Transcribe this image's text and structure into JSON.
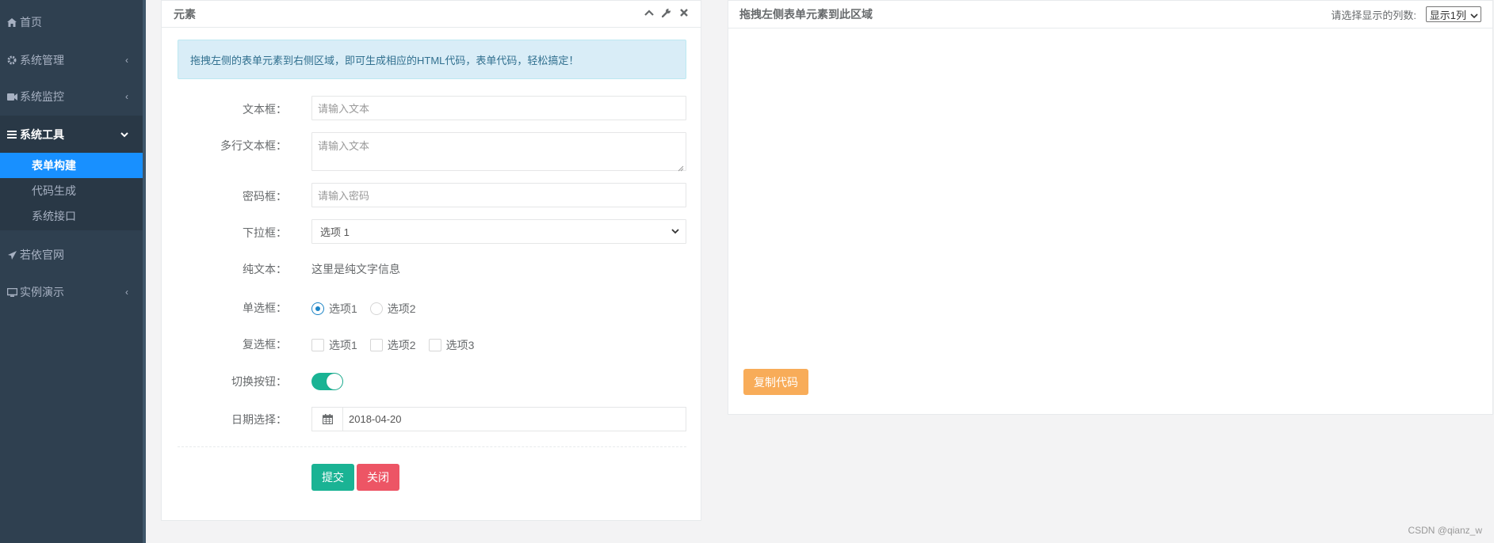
{
  "sidebar": {
    "items": [
      {
        "label": "首页",
        "icon": "home-icon"
      },
      {
        "label": "系统管理",
        "icon": "gear-icon"
      },
      {
        "label": "系统监控",
        "icon": "video-camera-icon"
      },
      {
        "label": "系统工具",
        "icon": "bars-icon"
      },
      {
        "label": "若依官网",
        "icon": "paper-plane-icon"
      },
      {
        "label": "实例演示",
        "icon": "desktop-icon"
      }
    ],
    "subitems": [
      {
        "label": "表单构建"
      },
      {
        "label": "代码生成"
      },
      {
        "label": "系统接口"
      }
    ]
  },
  "left_panel": {
    "title": "元素",
    "alert": "拖拽左侧的表单元素到右侧区域，即可生成相应的HTML代码，表单代码，轻松搞定！",
    "form": {
      "text_label": "文本框：",
      "text_placeholder": "请输入文本",
      "textarea_label": "多行文本框：",
      "textarea_placeholder": "请输入文本",
      "password_label": "密码框：",
      "password_placeholder": "请输入密码",
      "select_label": "下拉框：",
      "select_value": "选项 1",
      "static_label": "纯文本：",
      "static_value": "这里是纯文字信息",
      "radio_label": "单选框：",
      "radio_options": [
        "选项1",
        "选项2"
      ],
      "checkbox_label": "复选框：",
      "checkbox_options": [
        "选项1",
        "选项2",
        "选项3"
      ],
      "toggle_label": "切换按钮：",
      "date_label": "日期选择：",
      "date_value": "2018-04-20"
    },
    "buttons": {
      "submit": "提交",
      "close": "关闭"
    }
  },
  "right_panel": {
    "title": "拖拽左侧表单元素到此区域",
    "columns_label": "请选择显示的列数:",
    "columns_value": "显示1列",
    "copy_button": "复制代码"
  },
  "watermark": "CSDN @qianz_w",
  "colors": {
    "sidebar_bg": "#2f4050",
    "active_blue": "#1890ff",
    "primary_green": "#1ab394",
    "danger_red": "#ed5565",
    "warning_orange": "#f8ac59",
    "info_bg": "#d9edf7"
  }
}
